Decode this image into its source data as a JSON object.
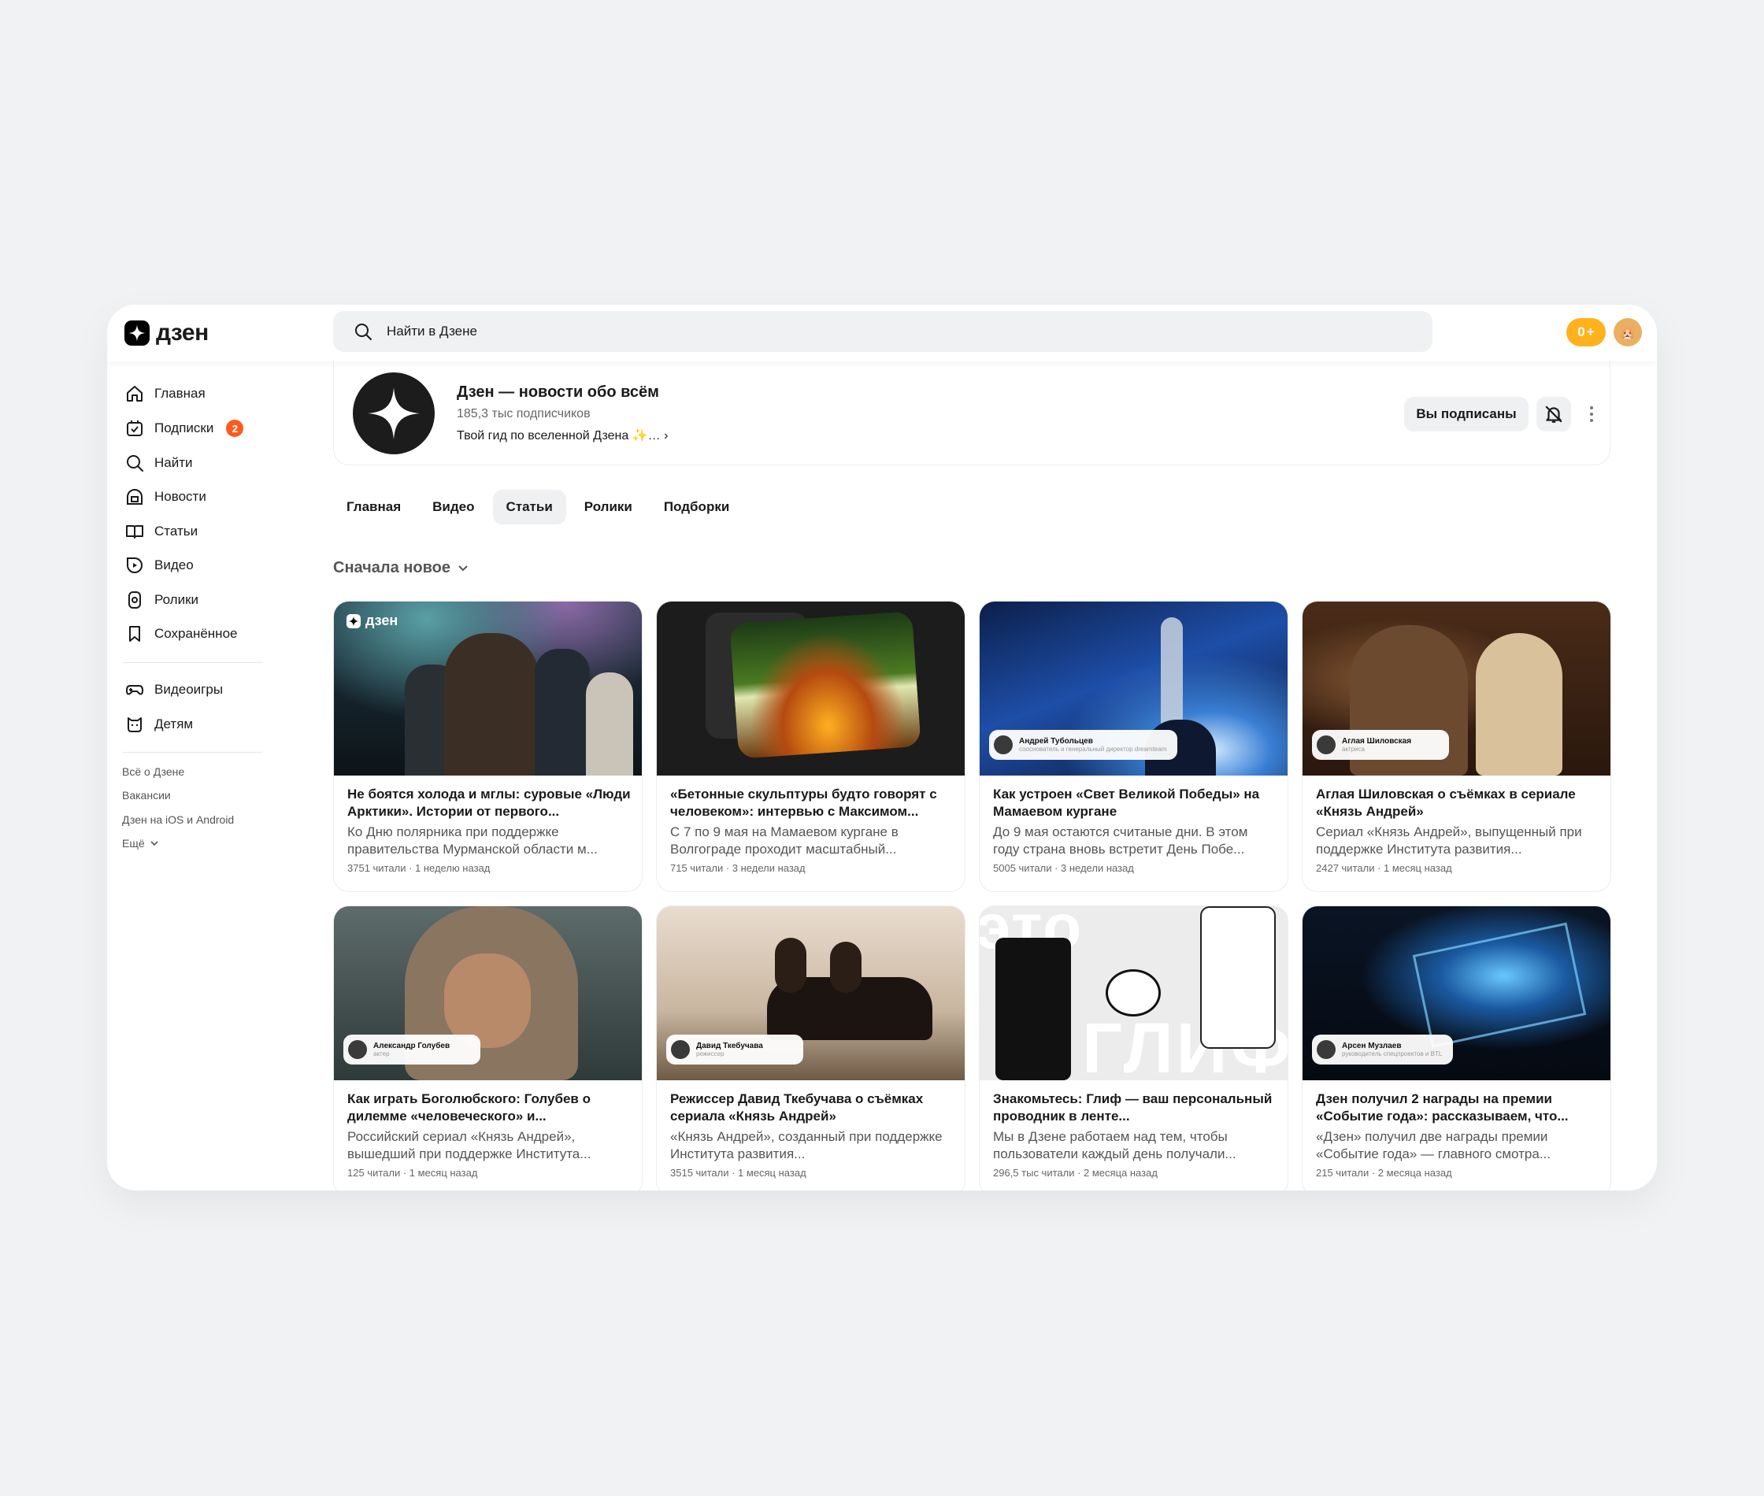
{
  "header": {
    "logo_text": "дзен",
    "search_placeholder": "Найти в Дзене",
    "coins_label": "0"
  },
  "sidebar": {
    "items": [
      {
        "label": "Главная",
        "icon": "home-icon"
      },
      {
        "label": "Подписки",
        "icon": "subscriptions-icon",
        "badge": "2"
      },
      {
        "label": "Найти",
        "icon": "search-icon"
      },
      {
        "label": "Новости",
        "icon": "news-icon"
      },
      {
        "label": "Статьи",
        "icon": "articles-icon"
      },
      {
        "label": "Видео",
        "icon": "video-icon"
      },
      {
        "label": "Ролики",
        "icon": "shorts-icon"
      },
      {
        "label": "Сохранённое",
        "icon": "bookmark-icon"
      }
    ],
    "extra": [
      {
        "label": "Видеоигры",
        "icon": "gamepad-icon"
      },
      {
        "label": "Детям",
        "icon": "kids-icon"
      }
    ],
    "footer": [
      "Всё о Дзене",
      "Вакансии",
      "Дзен на iOS и Android",
      "Ещё"
    ]
  },
  "channel": {
    "title": "Дзен — новости обо всём",
    "subscribers": "185,3 тыс подписчиков",
    "description": "Твой гид по вселенной Дзена ✨…",
    "subscribed_label": "Вы подписаны"
  },
  "tabs": [
    "Главная",
    "Видео",
    "Статьи",
    "Ролики",
    "Подборки"
  ],
  "active_tab": "Статьи",
  "sort_label": "Сначала новое",
  "cards": [
    {
      "title": "Не боятся холода и мглы: суровые «Люди Арктики». Истории от первого...",
      "desc": "Ко Дню полярника при поддержке правительства Мурманской области м...",
      "meta": "3751 читали · 1 неделю назад",
      "tag": "дзен"
    },
    {
      "title": "«Бетонные скульптуры будто говорят с человеком»: интервью с Максимом...",
      "desc": "С 7 по 9 мая на Мамаевом кургане в Волгограде проходит масштабный...",
      "meta": "715 читали · 3 недели назад"
    },
    {
      "title": "Как устроен «Свет Великой Победы» на Мамаевом кургане",
      "desc": "До 9 мая остаются считаные дни. В этом году страна вновь встретит День Побе...",
      "meta": "5005 читали · 3 недели назад",
      "author": "Андрей Тубольцев",
      "role": "сооснователь и генеральный директор dreamteam"
    },
    {
      "title": "Аглая Шиловская о съёмках в сериале «Князь Андрей»",
      "desc": "Сериал «Князь Андрей», выпущенный при поддержке Института развития...",
      "meta": "2427 читали · 1 месяц назад",
      "author": "Аглая Шиловская",
      "role": "актриса"
    },
    {
      "title": "Как играть Боголюбского: Голубев о дилемме «человеческого» и...",
      "desc": "Российский сериал «Князь Андрей», вышедший при поддержке Института...",
      "meta": "125 читали · 1 месяц назад",
      "author": "Александр Голубев",
      "role": "актер"
    },
    {
      "title": "Режиссер Давид Ткебучава о съёмках сериала «Князь Андрей»",
      "desc": "«Князь Андрей», созданный при поддержке Института развития...",
      "meta": "3515 читали · 1 месяц назад",
      "author": "Давид Ткебучава",
      "role": "режиссер"
    },
    {
      "title": "Знакомьтесь: Глиф — ваш персональный проводник в ленте...",
      "desc": "Мы в Дзене работаем над тем, чтобы пользователи каждый день получали...",
      "meta": "296,5 тыс читали · 2 месяца назад",
      "overlay_top": "это",
      "overlay_bottom": "глиф"
    },
    {
      "title": "Дзен получил 2 награды на премии «Событие года»: рассказываем, что...",
      "desc": "«Дзен» получил две награды премии «Событие года» — главного смотра...",
      "meta": "215 читали · 2 месяца назад",
      "author": "Арсен Музлаев",
      "role": "руководитель спецпроектов и BTL"
    }
  ]
}
